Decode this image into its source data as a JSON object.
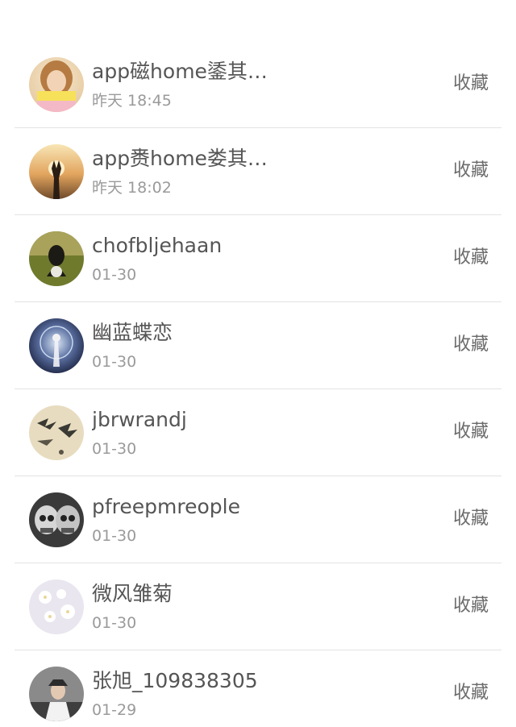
{
  "contacts": [
    {
      "name": "app磁home鋈其…",
      "time": "昨天 18:45",
      "action": "收藏",
      "avatar": "avatar-portrait-woman"
    },
    {
      "name": "app赉home娄其…",
      "time": "昨天 18:02",
      "action": "收藏",
      "avatar": "avatar-sunset-silhouette"
    },
    {
      "name": "chofbljehaan",
      "time": "01-30",
      "action": "收藏",
      "avatar": "avatar-green-figure"
    },
    {
      "name": "幽蓝蝶恋",
      "time": "01-30",
      "action": "收藏",
      "avatar": "avatar-blue-sparkle"
    },
    {
      "name": "jbrwrandj",
      "time": "01-30",
      "action": "收藏",
      "avatar": "avatar-swallows"
    },
    {
      "name": "pfreepmreople",
      "time": "01-30",
      "action": "收藏",
      "avatar": "avatar-skulls"
    },
    {
      "name": "微风雏菊",
      "time": "01-30",
      "action": "收藏",
      "avatar": "avatar-white-flowers"
    },
    {
      "name": "张旭_109838305",
      "time": "01-29",
      "action": "收藏",
      "avatar": "avatar-person-hat"
    }
  ]
}
